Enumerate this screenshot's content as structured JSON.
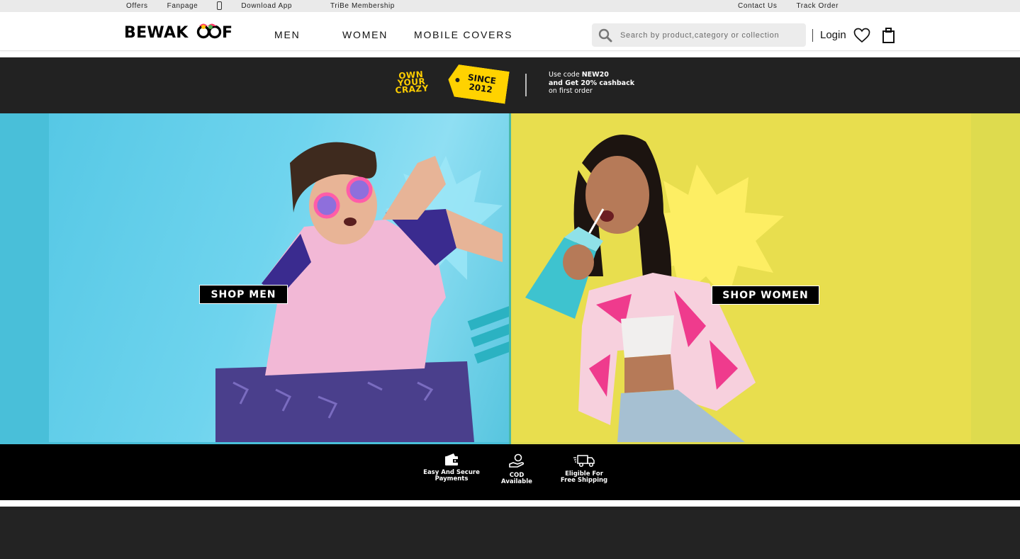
{
  "topbar": {
    "left": [
      "Offers",
      "Fanpage",
      "Download App",
      "TriBe Membership"
    ],
    "right": [
      "Contact Us",
      "Track Order"
    ]
  },
  "header": {
    "logo": "BEWAKOOF",
    "nav": [
      "MEN",
      "WOMEN",
      "MOBILE COVERS"
    ],
    "search_placeholder": "Search by product,category or collection",
    "login": "Login",
    "icons": [
      "search-icon",
      "heart-icon",
      "bag-icon"
    ]
  },
  "promo": {
    "tagline": "OWN YOUR CRAZY",
    "since_line1": "SINCE",
    "since_line2": "2012",
    "code_line1_prefix": "Use code ",
    "code": "NEW20",
    "code_line2": "and Get 20% cashback",
    "code_line3": "on first order"
  },
  "hero": {
    "men_cta": "SHOP MEN",
    "women_cta": "SHOP WOMEN",
    "colors": {
      "men_bg": "#56c8e5",
      "women_bg": "#e8de4e"
    }
  },
  "features": [
    {
      "line1": "Easy And Secure",
      "line2": "Payments",
      "icon": "wallet-icon"
    },
    {
      "line1": "COD",
      "line2": "Available",
      "icon": "cash-hand-icon"
    },
    {
      "line1": "Eligible For",
      "line2": "Free Shipping",
      "icon": "truck-icon"
    }
  ]
}
